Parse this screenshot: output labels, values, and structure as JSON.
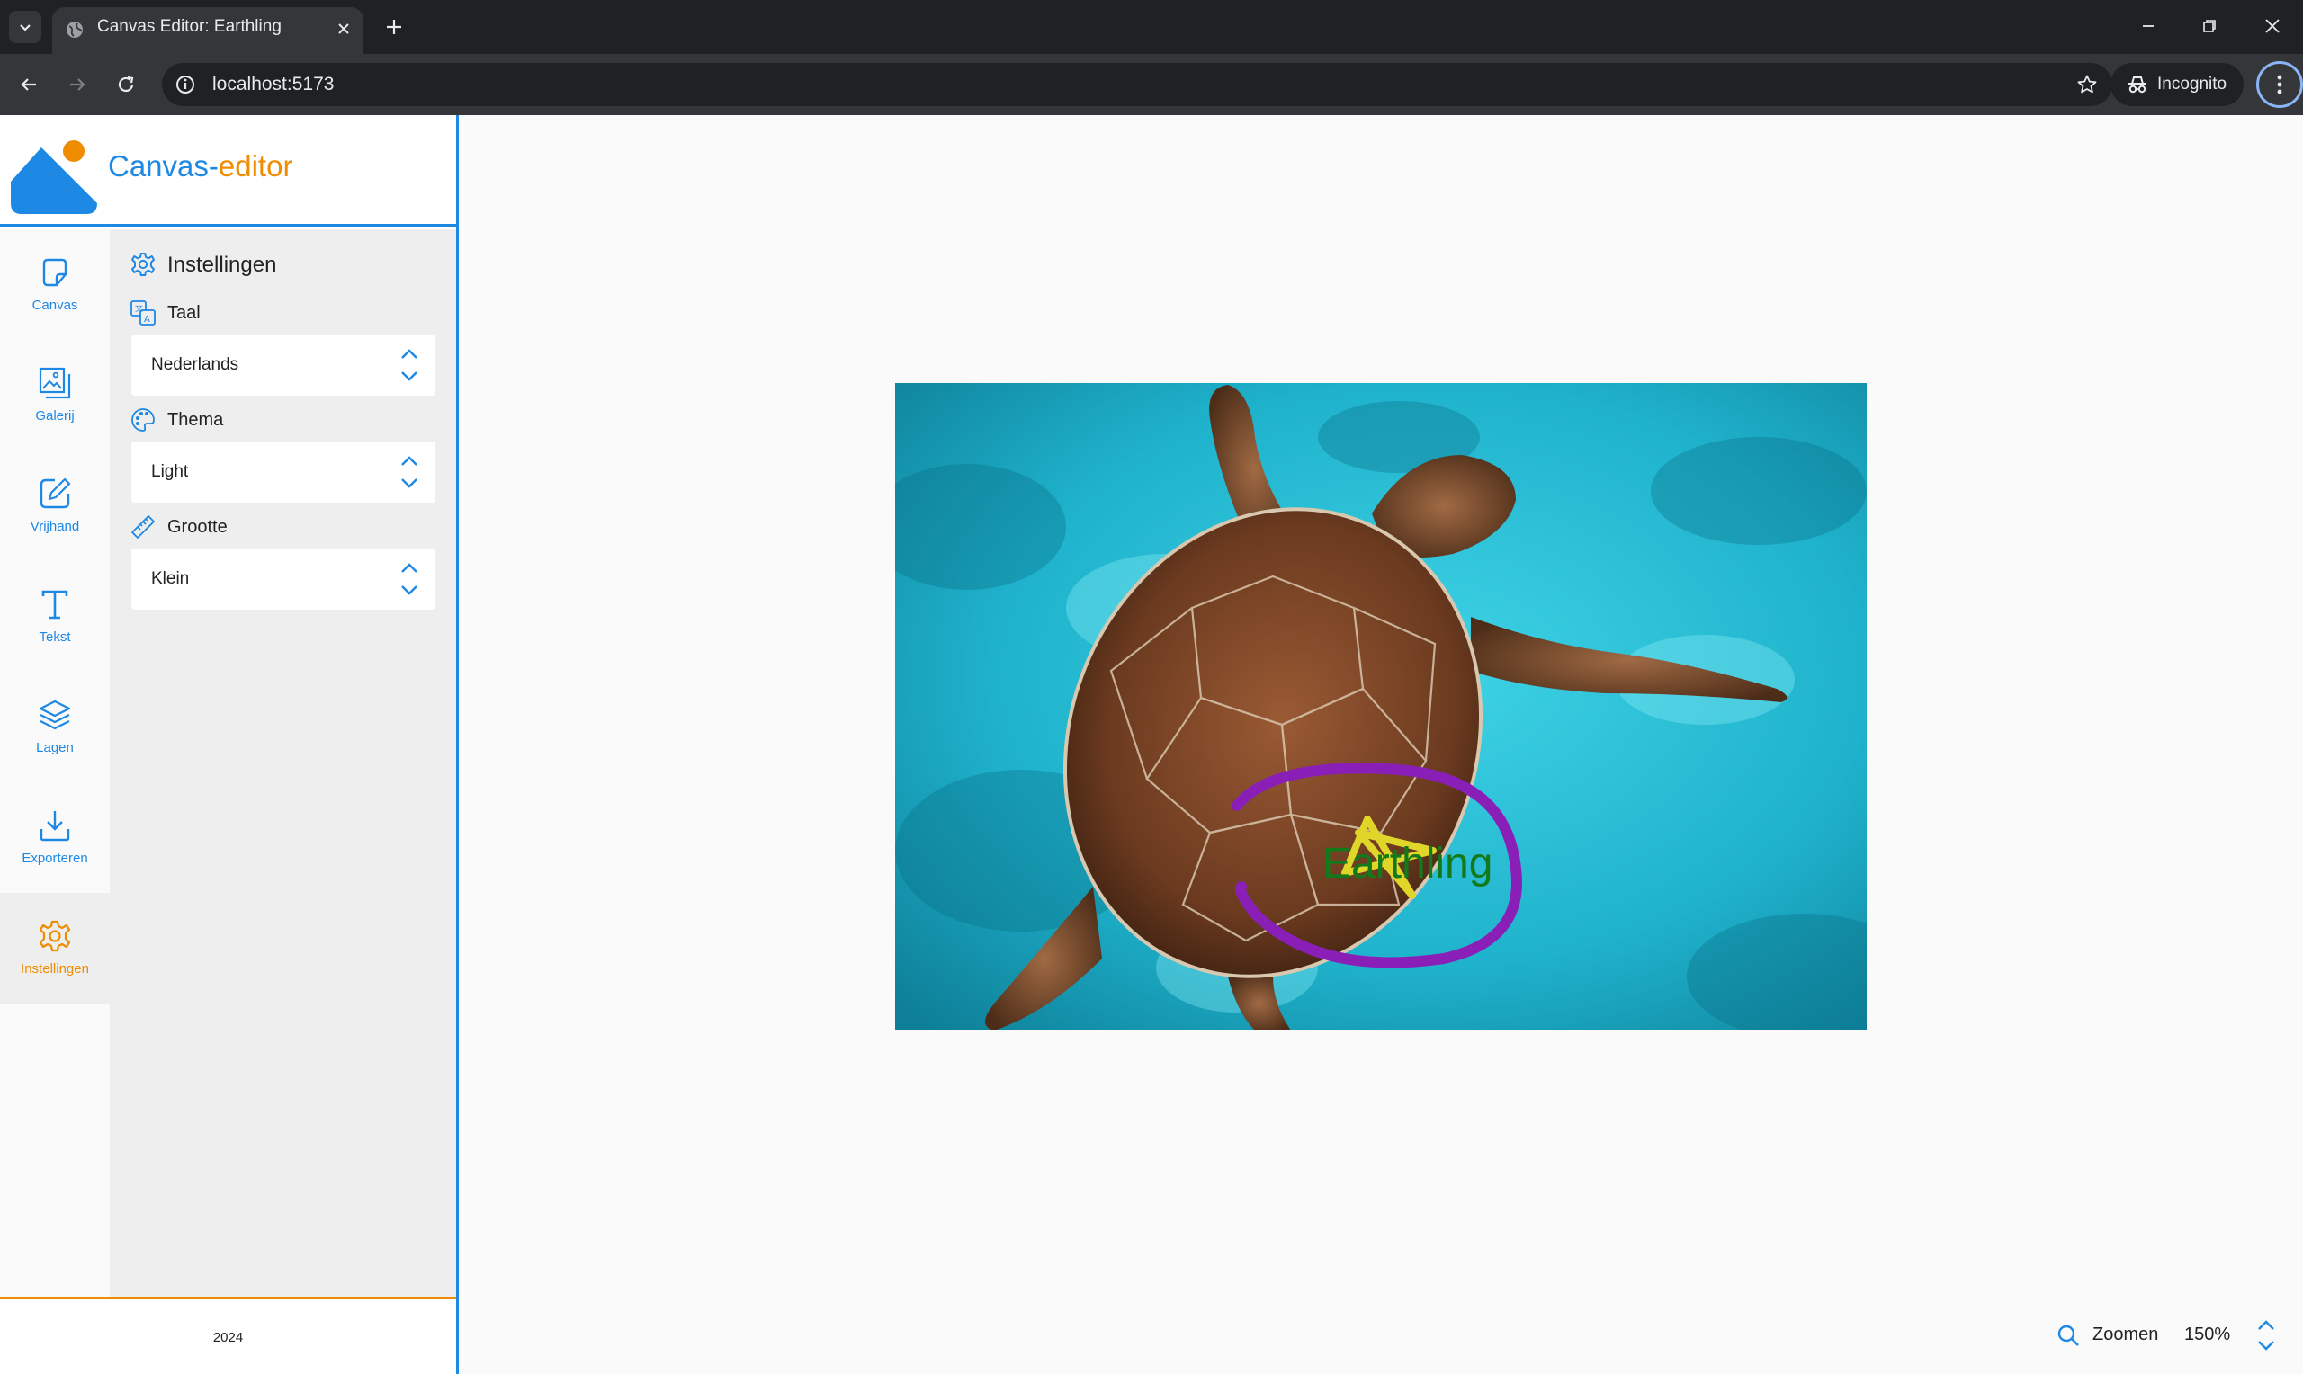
{
  "browser": {
    "tab_title": "Canvas Editor: Earthling",
    "url": "localhost:5173",
    "incognito_label": "Incognito"
  },
  "app": {
    "logo": {
      "word1": "Canvas",
      "separator": "-",
      "word2": "editor"
    },
    "nav": [
      {
        "label": "Canvas",
        "icon": "canvas-icon"
      },
      {
        "label": "Galerij",
        "icon": "gallery-icon"
      },
      {
        "label": "Vrijhand",
        "icon": "freehand-icon"
      },
      {
        "label": "Tekst",
        "icon": "text-icon"
      },
      {
        "label": "Lagen",
        "icon": "layers-icon"
      },
      {
        "label": "Exporteren",
        "icon": "export-icon"
      },
      {
        "label": "Instellingen",
        "icon": "settings-icon",
        "active": true
      }
    ],
    "settings": {
      "title": "Instellingen",
      "language": {
        "label": "Taal",
        "value": "Nederlands"
      },
      "theme": {
        "label": "Thema",
        "value": "Light"
      },
      "size": {
        "label": "Grootte",
        "value": "Klein"
      }
    },
    "footer_year": "2024",
    "canvas": {
      "overlay_text": "Earthling"
    },
    "zoom": {
      "label": "Zoomen",
      "value": "150%"
    }
  },
  "colors": {
    "primary": "#1e88e5",
    "accent": "#ef8c00",
    "browser_dark": "#202124",
    "browser_toolbar": "#35363a"
  }
}
